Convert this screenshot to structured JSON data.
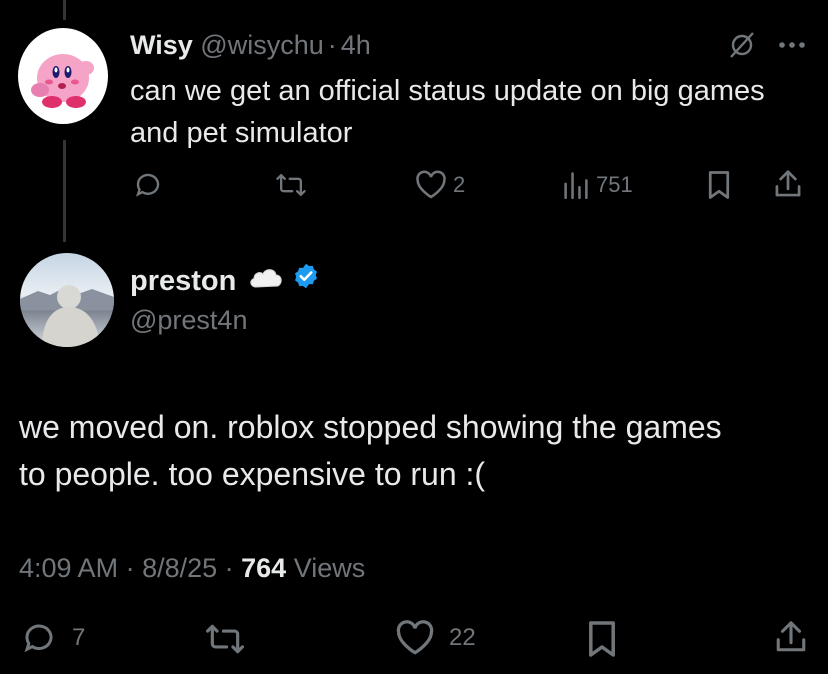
{
  "reply": {
    "name": "Wisy",
    "handle": "@wisychu",
    "sep": "·",
    "time": "4h",
    "text": "can we get an official status update on big games and pet simulator",
    "likes": "2",
    "views": "751",
    "avatar_icon": "kirby-avatar"
  },
  "main": {
    "name": "preston",
    "emoji": "☁️",
    "handle": "@prest4n",
    "text": "we moved on. roblox stopped showing the games to people. too expensive to run :(",
    "time": "4:09 AM",
    "date": "8/8/25",
    "views_count": "764",
    "views_label": "Views",
    "replies": "7",
    "likes": "22",
    "verified_color": "#1d9bf0"
  },
  "colors": {
    "accent": "#1d9bf0",
    "muted": "#71767b",
    "text": "#e7e9ea"
  }
}
